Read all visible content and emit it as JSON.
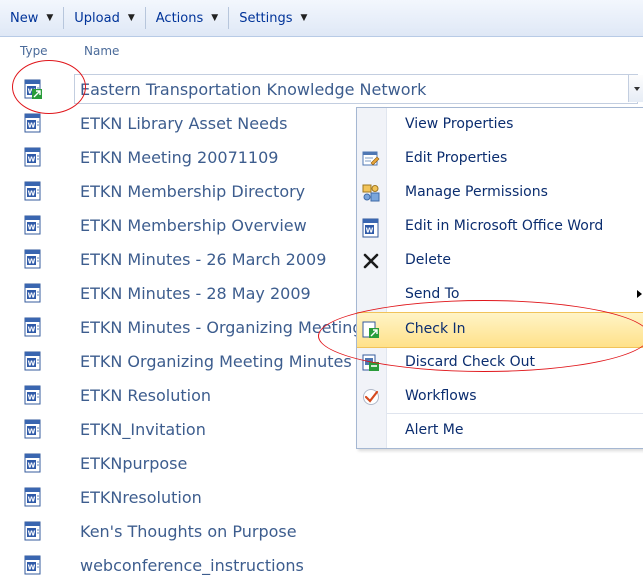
{
  "toolbar": {
    "items": [
      {
        "label": "New",
        "has_dropdown": true
      },
      {
        "label": "Upload",
        "has_dropdown": true
      },
      {
        "label": "Actions",
        "has_dropdown": true
      },
      {
        "label": "Settings",
        "has_dropdown": true
      }
    ]
  },
  "columns": {
    "type": "Type",
    "name": "Name"
  },
  "documents": [
    {
      "name": "Eastern Transportation Knowledge Network",
      "icon": "word-doc-checked-out-icon",
      "selected": true
    },
    {
      "name": "ETKN Library Asset Needs",
      "icon": "word-doc-icon"
    },
    {
      "name": "ETKN Meeting 20071109",
      "icon": "word-doc-icon"
    },
    {
      "name": "ETKN Membership Directory",
      "icon": "word-doc-icon"
    },
    {
      "name": "ETKN Membership Overview",
      "icon": "word-doc-icon"
    },
    {
      "name": "ETKN Minutes - 26 March 2009",
      "icon": "word-doc-icon"
    },
    {
      "name": "ETKN Minutes - 28 May 2009",
      "icon": "word-doc-icon"
    },
    {
      "name": "ETKN Minutes - Organizing Meeting",
      "icon": "word-doc-icon"
    },
    {
      "name": "ETKN Organizing Meeting Minutes",
      "icon": "word-doc-icon"
    },
    {
      "name": "ETKN Resolution",
      "icon": "word-doc-icon"
    },
    {
      "name": "ETKN_Invitation",
      "icon": "word-doc-icon"
    },
    {
      "name": "ETKNpurpose",
      "icon": "word-doc-icon"
    },
    {
      "name": "ETKNresolution",
      "icon": "word-doc-icon"
    },
    {
      "name": "Ken's Thoughts on Purpose",
      "icon": "word-doc-icon"
    },
    {
      "name": "webconference_instructions",
      "icon": "word-doc-icon"
    }
  ],
  "context_menu": {
    "items": [
      {
        "label": "View Properties",
        "icon": ""
      },
      {
        "label": "Edit Properties",
        "icon": "edit-properties-icon"
      },
      {
        "label": "Manage Permissions",
        "icon": "manage-permissions-icon"
      },
      {
        "label": "Edit in Microsoft Office Word",
        "icon": "word-doc-icon"
      },
      {
        "label": "Delete",
        "icon": "delete-x-icon"
      },
      {
        "label": "Send To",
        "icon": "",
        "submenu": true
      },
      {
        "label": "Check In",
        "icon": "check-in-icon",
        "highlighted": true
      },
      {
        "label": "Discard Check Out",
        "icon": "discard-check-out-icon"
      },
      {
        "label": "Workflows",
        "icon": "workflows-icon"
      },
      {
        "label": "Alert Me",
        "icon": ""
      }
    ]
  },
  "colors": {
    "link_text": "#3d5d8e",
    "menu_text": "#0b2d6f",
    "highlight": "#ffe18a",
    "annotation_red": "#e0161b"
  }
}
